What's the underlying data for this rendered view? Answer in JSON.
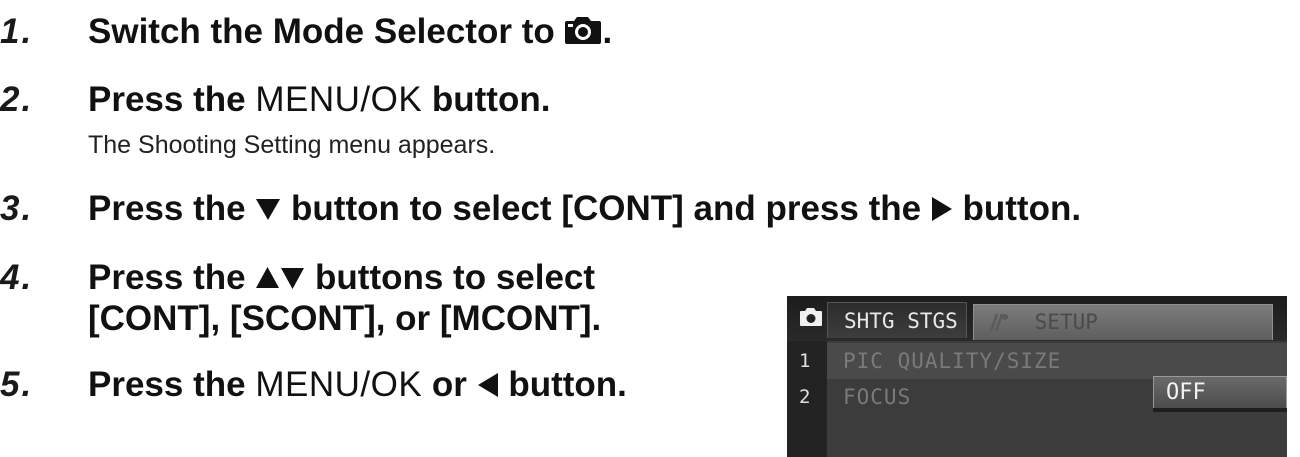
{
  "steps": [
    {
      "num": "1.",
      "before": "Switch the Mode Selector to ",
      "icon": "camera-icon",
      "after": "."
    },
    {
      "num": "2.",
      "before": "Press the ",
      "menu_ok": "MENU/OK",
      "after": " button."
    },
    {
      "num": "3.",
      "before": "Press the ",
      "icon": "down-arrow-icon",
      "middle": " button to select [CONT] and press the ",
      "icon2": "right-arrow-icon",
      "after": " button."
    },
    {
      "num": "4.",
      "line1_before": "Press the ",
      "icon": "up-down-arrows-icon",
      "line1_after": " buttons to select",
      "line2": "[CONT], [SCONT], or [MCONT]."
    },
    {
      "num": "5.",
      "before": "Press the ",
      "menu_ok": "MENU/OK",
      "middle": " or ",
      "icon": "left-arrow-icon",
      "after": " button."
    }
  ],
  "note_step2": "The Shooting Setting menu appears.",
  "screen": {
    "active_tab": "SHTG STGS",
    "inactive_tab": "SETUP",
    "inactive_tab_icon": "setup-icon",
    "tab_icon": "camera-icon",
    "rows": [
      {
        "num": "1",
        "label": "PIC QUALITY/SIZE"
      },
      {
        "num": "2",
        "label": "FOCUS"
      }
    ],
    "dropdown_value": "OFF"
  }
}
